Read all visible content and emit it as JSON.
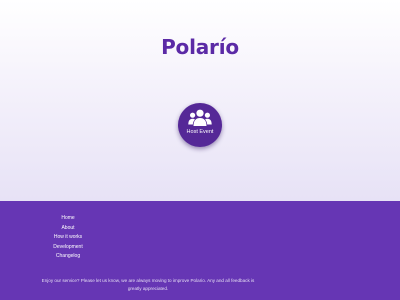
{
  "header": {
    "logo_text": "Polarío"
  },
  "host_event": {
    "icon": "group-icon",
    "label": "Host Event"
  },
  "footer": {
    "nav": [
      {
        "label": "Home"
      },
      {
        "label": "About"
      },
      {
        "label": "How it works"
      },
      {
        "label": "Development"
      },
      {
        "label": "Changelog"
      }
    ],
    "feedback_text": "Enjoy our service? Please let us know, we are always moving to improve Polario. Any and all feedback is greatly appreciated."
  },
  "colors": {
    "brand": "#5b2aa6",
    "button": "#552897",
    "footer": "#6636b4"
  }
}
